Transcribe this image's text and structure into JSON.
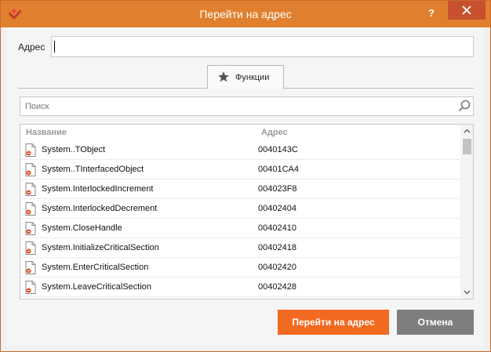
{
  "window": {
    "title": "Перейти на адрес",
    "help_label": "?",
    "accent_color": "#e0802e"
  },
  "address": {
    "label": "Адрес",
    "value": ""
  },
  "tabs": [
    {
      "label": "Функции",
      "icon": "star-icon",
      "active": true
    }
  ],
  "search": {
    "placeholder": "Поиск"
  },
  "list": {
    "columns": [
      "Название",
      "Адрес"
    ],
    "rows": [
      {
        "name": "System..TObject",
        "address": "0040143C"
      },
      {
        "name": "System..TInterfacedObject",
        "address": "00401CA4"
      },
      {
        "name": "System.InterlockedIncrement",
        "address": "004023F8"
      },
      {
        "name": "System.InterlockedDecrement",
        "address": "00402404"
      },
      {
        "name": "System.CloseHandle",
        "address": "00402410"
      },
      {
        "name": "System.InitializeCriticalSection",
        "address": "00402418"
      },
      {
        "name": "System.EnterCriticalSection",
        "address": "00402420"
      },
      {
        "name": "System.LeaveCriticalSection",
        "address": "00402428"
      }
    ]
  },
  "buttons": {
    "go_label": "Перейти на адрес",
    "cancel_label": "Отмена",
    "go_color": "#f26a21",
    "cancel_color": "#7c7e80"
  }
}
